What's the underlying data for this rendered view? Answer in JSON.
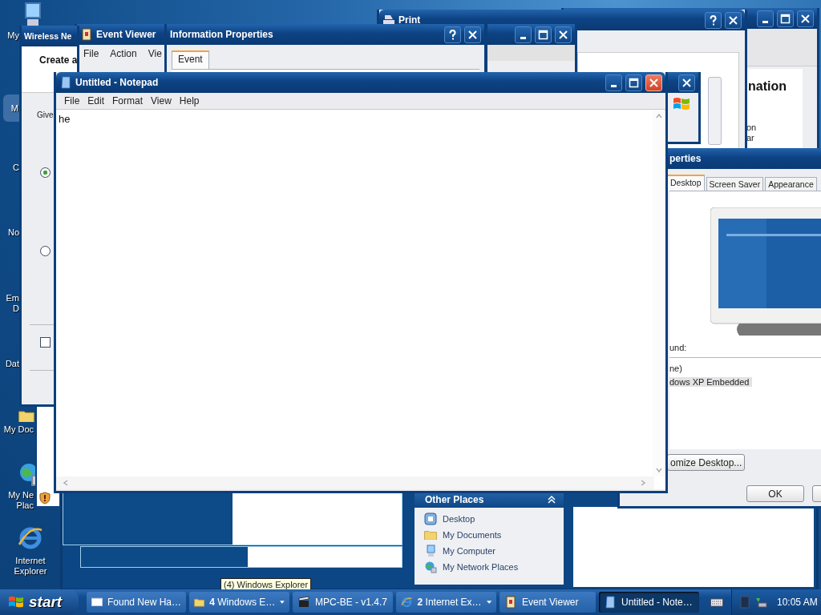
{
  "desktop_icons": [
    {
      "kind": "computer",
      "lines": [
        "My"
      ],
      "selected": false
    },
    {
      "kind": "none",
      "lines": [
        "M"
      ],
      "selected": true
    },
    {
      "kind": "none",
      "lines": [
        "C"
      ],
      "selected": false
    },
    {
      "kind": "none",
      "lines": [
        "No"
      ],
      "selected": false
    },
    {
      "kind": "none",
      "lines": [
        "Em",
        "D"
      ],
      "selected": false
    },
    {
      "kind": "none",
      "lines": [
        "Dat"
      ],
      "selected": false
    },
    {
      "kind": "folder",
      "lines": [
        "My Doc"
      ],
      "selected": false
    },
    {
      "kind": "network",
      "lines": [
        "My Ne",
        "Plac"
      ],
      "selected": false
    },
    {
      "kind": "browser",
      "lines": [
        "Internet",
        "Explorer"
      ],
      "selected": false
    }
  ],
  "back_window": {
    "heading": "nation",
    "lines": [
      "on",
      "ar"
    ]
  },
  "print_window": {
    "title": "Print"
  },
  "info_properties": {
    "title": "Information Properties",
    "tabs": [
      {
        "label": "Event",
        "selected": true
      }
    ]
  },
  "event_viewer": {
    "title": "Event Viewer",
    "menu": [
      "File",
      "Action",
      "Vie"
    ]
  },
  "wireless_wizard": {
    "title": "Wireless Ne",
    "heading": "Create a",
    "prompt": "Give",
    "options": [
      {
        "checked": true
      },
      {
        "checked": false
      }
    ],
    "checkbox": {
      "checked": false
    }
  },
  "explorer": {
    "other_places": {
      "title": "Other Places",
      "items": [
        {
          "kind": "desktop",
          "label": "Desktop"
        },
        {
          "kind": "documents",
          "label": "My Documents"
        },
        {
          "kind": "computer",
          "label": "My Computer"
        },
        {
          "kind": "network",
          "label": "My Network Places"
        }
      ]
    }
  },
  "display_properties": {
    "title": "perties",
    "tabs": [
      {
        "label": "Desktop",
        "selected": true
      },
      {
        "label": "Screen Saver",
        "selected": false
      },
      {
        "label": "Appearance",
        "selected": false
      }
    ],
    "background_label": "und:",
    "backgrounds": [
      {
        "label": "ne)",
        "selected": false
      },
      {
        "label": "dows XP Embedded",
        "selected": true
      }
    ],
    "customize_button": "omize Desktop...",
    "ok_button": "OK"
  },
  "notepad": {
    "title": "Untitled - Notepad",
    "menu": [
      "File",
      "Edit",
      "Format",
      "View",
      "Help"
    ],
    "text": "he"
  },
  "tooltip": "(4) Windows Explorer",
  "taskbar": {
    "start": "start",
    "buttons": [
      {
        "kind": "window",
        "label": "Found New Ha…",
        "grouped": false,
        "selected": false
      },
      {
        "kind": "folder",
        "label": "**4** Windows E…",
        "grouped": true,
        "selected": false
      },
      {
        "kind": "film",
        "label": "MPC-BE - v1.4.7",
        "grouped": false,
        "selected": false
      },
      {
        "kind": "browser",
        "label": "**2** Internet Ex…",
        "grouped": true,
        "selected": false
      },
      {
        "kind": "event",
        "label": "Event Viewer",
        "grouped": false,
        "selected": false
      },
      {
        "kind": "notepad",
        "label": "Untitled - Note…",
        "grouped": false,
        "selected": true
      }
    ],
    "clock": "10:05 AM"
  }
}
